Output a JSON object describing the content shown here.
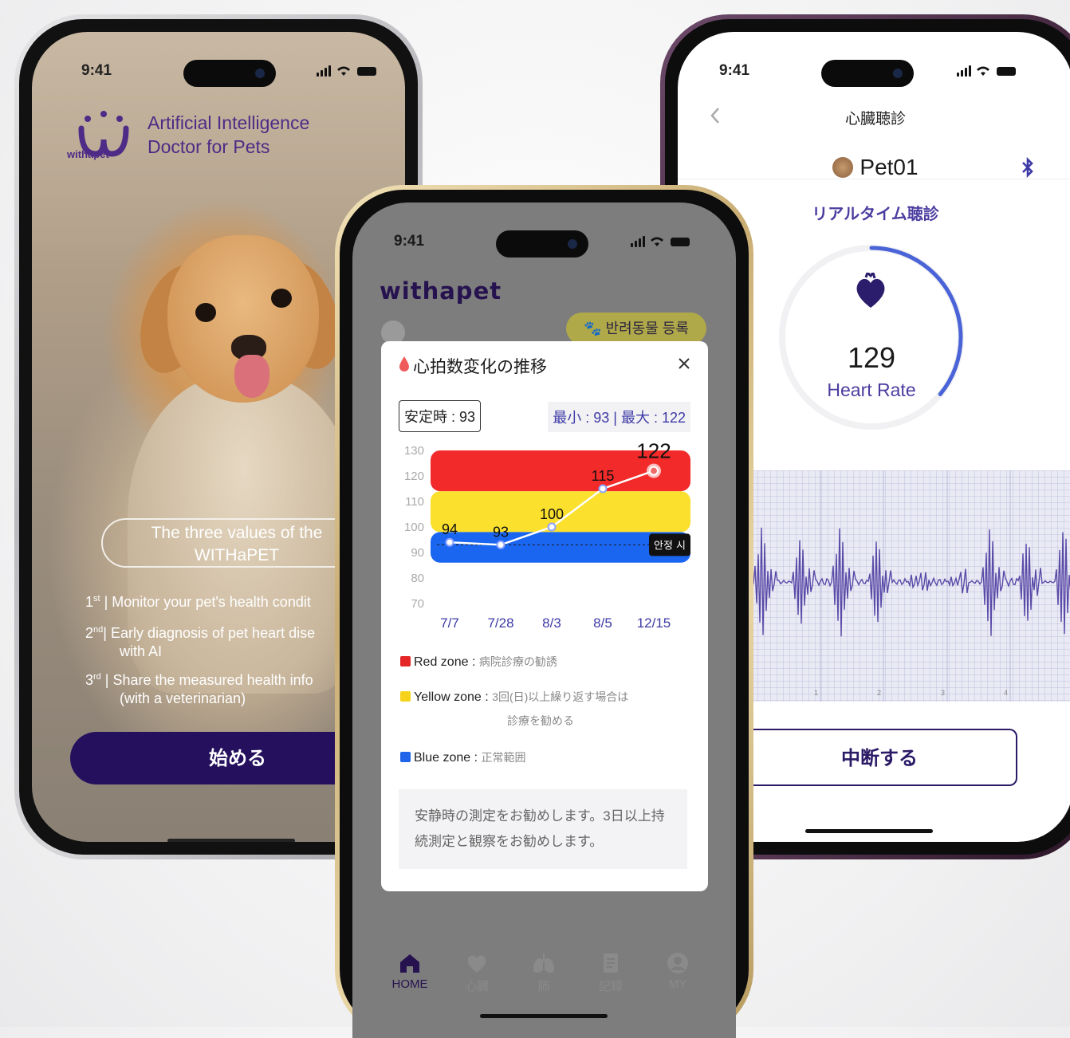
{
  "status_time": "9:41",
  "left_screen": {
    "logo_text": "withapet",
    "tagline_1": "Artificial Intelligence",
    "tagline_2": "Doctor for Pets",
    "values_title_1": "The three values of the",
    "values_title_2": "WITHaPET",
    "values": [
      {
        "ordinal": "1",
        "suffix": "st",
        "text": "Monitor your pet's health condit"
      },
      {
        "ordinal": "2",
        "suffix": "nd",
        "text": "Early diagnosis of pet heart dise",
        "text2": "with AI"
      },
      {
        "ordinal": "3",
        "suffix": "rd",
        "text": "Share the measured health info",
        "text2": "(with a veterinarian)"
      }
    ],
    "start_label": "始める"
  },
  "middle_screen": {
    "logo_text": "withapet",
    "register_button": "반려동물 등록",
    "modal": {
      "title": "心拍数変化の推移",
      "resting_badge": "安定時 : 93",
      "minmax": "最小 : 93 | 最大 : 122",
      "resting_tag": "안정 시",
      "legend": [
        {
          "name": "Red zone :",
          "note": "病院診療の勧誘",
          "color": "#e52626"
        },
        {
          "name": "Yellow zone :",
          "note": "3回(日)以上繰り返す場合は",
          "note2": "診療を勧める",
          "color": "#f6d31a"
        },
        {
          "name": "Blue zone :",
          "note": "正常範囲",
          "color": "#1f64ea"
        }
      ],
      "notice": "安静時の測定をお勧めします。3日以上持続測定と観察をお勧めします。"
    },
    "nav": [
      {
        "label": "HOME"
      },
      {
        "label": "心臓"
      },
      {
        "label": "肺"
      },
      {
        "label": "記録"
      },
      {
        "label": "MY"
      }
    ]
  },
  "chart_data": {
    "type": "line",
    "categories": [
      "7/7",
      "7/28",
      "8/3",
      "8/5",
      "12/15"
    ],
    "values": [
      94,
      93,
      100,
      115,
      122
    ],
    "value_labels": [
      "94",
      "93",
      "100",
      "115",
      "122"
    ],
    "y_ticks": [
      "130",
      "120",
      "110",
      "100",
      "90",
      "80",
      "70"
    ],
    "ylim": [
      70,
      130
    ],
    "zones": [
      {
        "name": "Red zone",
        "from": 114,
        "to": 130,
        "color": "#f22a2a"
      },
      {
        "name": "Yellow zone",
        "from": 98,
        "to": 114,
        "color": "#fbe02d"
      },
      {
        "name": "Blue zone",
        "from": 86,
        "to": 98,
        "color": "#1a66f0"
      }
    ],
    "resting_value": 93,
    "grid": false,
    "xlabel": "",
    "ylabel": ""
  },
  "right_screen": {
    "title": "心臓聴診",
    "pet_name": "Pet01",
    "section_label": "リアルタイム聴診",
    "heart_rate_value": "129",
    "heart_rate_label": "Heart Rate",
    "ecg_marks": [
      "1",
      "2",
      "3",
      "4"
    ],
    "stop_label": "中断する",
    "ring_progress": 0.36
  },
  "colors": {
    "brand_purple": "#4d2b86",
    "button_navy": "#25105e",
    "accent_blue": "#4a64d8",
    "ecg_line": "#5a4aa8"
  }
}
